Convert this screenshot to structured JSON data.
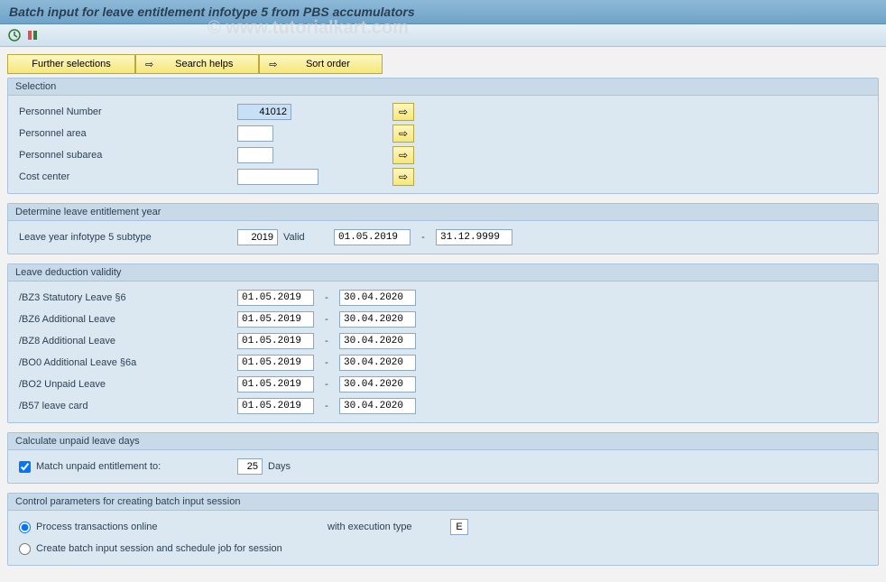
{
  "title": "Batch input for leave entitlement infotype 5 from PBS accumulators",
  "watermark": "© www.tutorialkart.com",
  "toolbar": {
    "further_selections": "Further selections",
    "search_helps": "Search helps",
    "sort_order": "Sort order"
  },
  "panels": {
    "selection": {
      "title": "Selection",
      "rows": [
        {
          "label": "Personnel Number",
          "value": "41012"
        },
        {
          "label": "Personnel area",
          "value": ""
        },
        {
          "label": "Personnel subarea",
          "value": ""
        },
        {
          "label": "Cost center",
          "value": ""
        }
      ]
    },
    "determine_year": {
      "title": "Determine leave entitlement year",
      "label": "Leave year infotype 5 subtype",
      "year": "2019",
      "valid_label": "Valid",
      "from": "01.05.2019",
      "dash": "-",
      "to": "31.12.9999"
    },
    "leave_deduction": {
      "title": "Leave deduction validity",
      "rows": [
        {
          "label": "/BZ3 Statutory Leave §6",
          "from": "01.05.2019",
          "to": "30.04.2020"
        },
        {
          "label": "/BZ6 Additional Leave",
          "from": "01.05.2019",
          "to": "30.04.2020"
        },
        {
          "label": "/BZ8 Additional Leave",
          "from": "01.05.2019",
          "to": "30.04.2020"
        },
        {
          "label": "/BO0 Additional Leave §6a",
          "from": "01.05.2019",
          "to": "30.04.2020"
        },
        {
          "label": "/BO2 Unpaid Leave",
          "from": "01.05.2019",
          "to": "30.04.2020"
        },
        {
          "label": "/B57 leave card",
          "from": "01.05.2019",
          "to": "30.04.2020"
        }
      ],
      "dash": "-"
    },
    "calculate_unpaid": {
      "title": "Calculate unpaid leave days",
      "checkbox_label": "Match unpaid entitlement to:",
      "days_value": "25",
      "days_label": "Days"
    },
    "control_params": {
      "title": "Control parameters for creating batch input session",
      "radio1": "Process transactions online",
      "exec_label": "with execution type",
      "exec_value": "E",
      "radio2": "Create batch input session and schedule job for session"
    }
  }
}
